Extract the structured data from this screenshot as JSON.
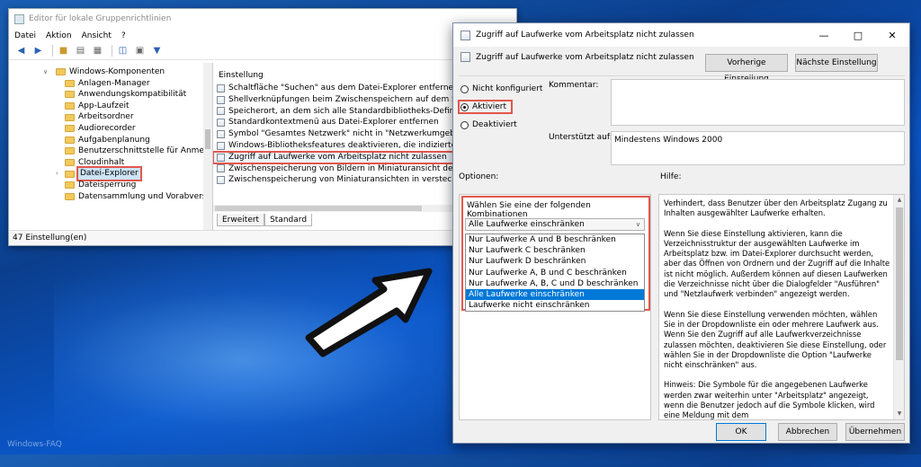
{
  "gpe": {
    "title": "Editor für lokale Gruppenrichtlinien",
    "menu": [
      "Datei",
      "Aktion",
      "Ansicht",
      "?"
    ],
    "tree": [
      {
        "label": "Windows-Komponenten",
        "level": 0,
        "expanded": true
      },
      {
        "label": "Anlagen-Manager",
        "level": 1
      },
      {
        "label": "Anwendungskompatibilität",
        "level": 1
      },
      {
        "label": "App-Laufzeit",
        "level": 1
      },
      {
        "label": "Arbeitsordner",
        "level": 1
      },
      {
        "label": "Audiorecorder",
        "level": 1
      },
      {
        "label": "Aufgabenplanung",
        "level": 1
      },
      {
        "label": "Benutzerschnittstelle für Anmeldeinformationen",
        "level": 1
      },
      {
        "label": "Cloudinhalt",
        "level": 1
      },
      {
        "label": "Datei-Explorer",
        "level": 1,
        "selected": true
      },
      {
        "label": "Dateisperrung",
        "level": 1
      },
      {
        "label": "Datensammlung und Vorabversionen",
        "level": 1
      }
    ],
    "list_header": "Einstellung",
    "settings": [
      "Schaltfläche \"Suchen\" aus dem Datei-Explorer entfernen",
      "Shellverknüpfungen beim Zwischenspeichern auf dem Server nicht verfolgen",
      "Speicherort, an dem sich alle Standardbibliotheks-Definitionsdateien befinden",
      "Standardkontextmenü aus Datei-Explorer entfernen",
      "Symbol \"Gesamtes Netzwerk\" nicht in \"Netzwerkumgebung\" anzeigen",
      "Windows-Bibliotheksfeatures deaktivieren, die indizierte Dateidaten benötigen",
      "Zugriff auf Laufwerke vom Arbeitsplatz nicht zulassen",
      "Zwischenspeicherung von Bildern in Miniaturansicht deaktivieren",
      "Zwischenspeicherung von Miniaturansichten in versteckten thumbs.db-Dateien"
    ],
    "highlighted_index": 6,
    "tabs": [
      "Erweitert",
      "Standard"
    ],
    "status": "47 Einstellung(en)"
  },
  "dialog": {
    "title": "Zugriff auf Laufwerke vom Arbeitsplatz nicht zulassen",
    "policy_title": "Zugriff auf Laufwerke vom Arbeitsplatz nicht zulassen",
    "prev_button": "Vorherige Einstellung",
    "next_button": "Nächste Einstellung",
    "radio_not_configured": "Nicht konfiguriert",
    "radio_enabled": "Aktiviert",
    "radio_disabled": "Deaktiviert",
    "comment_label": "Kommentar:",
    "supported_label": "Unterstützt auf:",
    "supported_value": "Mindestens Windows 2000",
    "options_label": "Optionen:",
    "help_label": "Hilfe:",
    "combo_title": "Wählen Sie eine der folgenden Kombinationen",
    "combo_value": "Alle Laufwerke einschränken",
    "combo_options": [
      "Nur Laufwerke A und B beschränken",
      "Nur Laufwerk C beschränken",
      "Nur Laufwerk D beschränken",
      "Nur Laufwerke A, B und C beschränken",
      "Nur Laufwerke A, B, C und D beschränken",
      "Alle Laufwerke einschränken",
      "Laufwerke nicht einschränken"
    ],
    "selected_option_index": 5,
    "help_paragraphs": [
      "Verhindert, dass Benutzer über den Arbeitsplatz Zugang zu Inhalten ausgewählter Laufwerke erhalten.",
      "Wenn Sie diese Einstellung aktivieren, kann die Verzeichnisstruktur der ausgewählten Laufwerke im Arbeitsplatz bzw. im Datei-Explorer durchsucht werden, aber das Öffnen von Ordnern und der Zugriff auf die Inhalte ist nicht möglich. Außerdem können auf diesen Laufwerken die Verzeichnisse nicht über die Dialogfelder \"Ausführen\" und \"Netzlaufwerk verbinden\" angezeigt werden.",
      "Wenn Sie diese Einstellung verwenden möchten, wählen Sie in der Dropdownliste ein oder mehrere Laufwerk aus. Wenn Sie den Zugriff auf alle Laufwerkverzeichnisse zulassen möchten, deaktivieren Sie diese Einstellung, oder wählen Sie in der Dropdownliste die Option \"Laufwerke nicht einschränken\" aus.",
      "Hinweis: Die Symbole für die angegebenen Laufwerke werden zwar weiterhin unter \"Arbeitsplatz\" angezeigt, wenn die Benutzer jedoch auf die Symbole klicken, wird eine Meldung mit dem"
    ],
    "ok_button": "OK",
    "cancel_button": "Abbrechen",
    "apply_button": "Übernehmen"
  },
  "watermark": "Windows-FAQ",
  "colors": {
    "highlight_red": "#e2574c",
    "selection_blue": "#0078d7",
    "desktop_blue": "#0b4fa8"
  }
}
